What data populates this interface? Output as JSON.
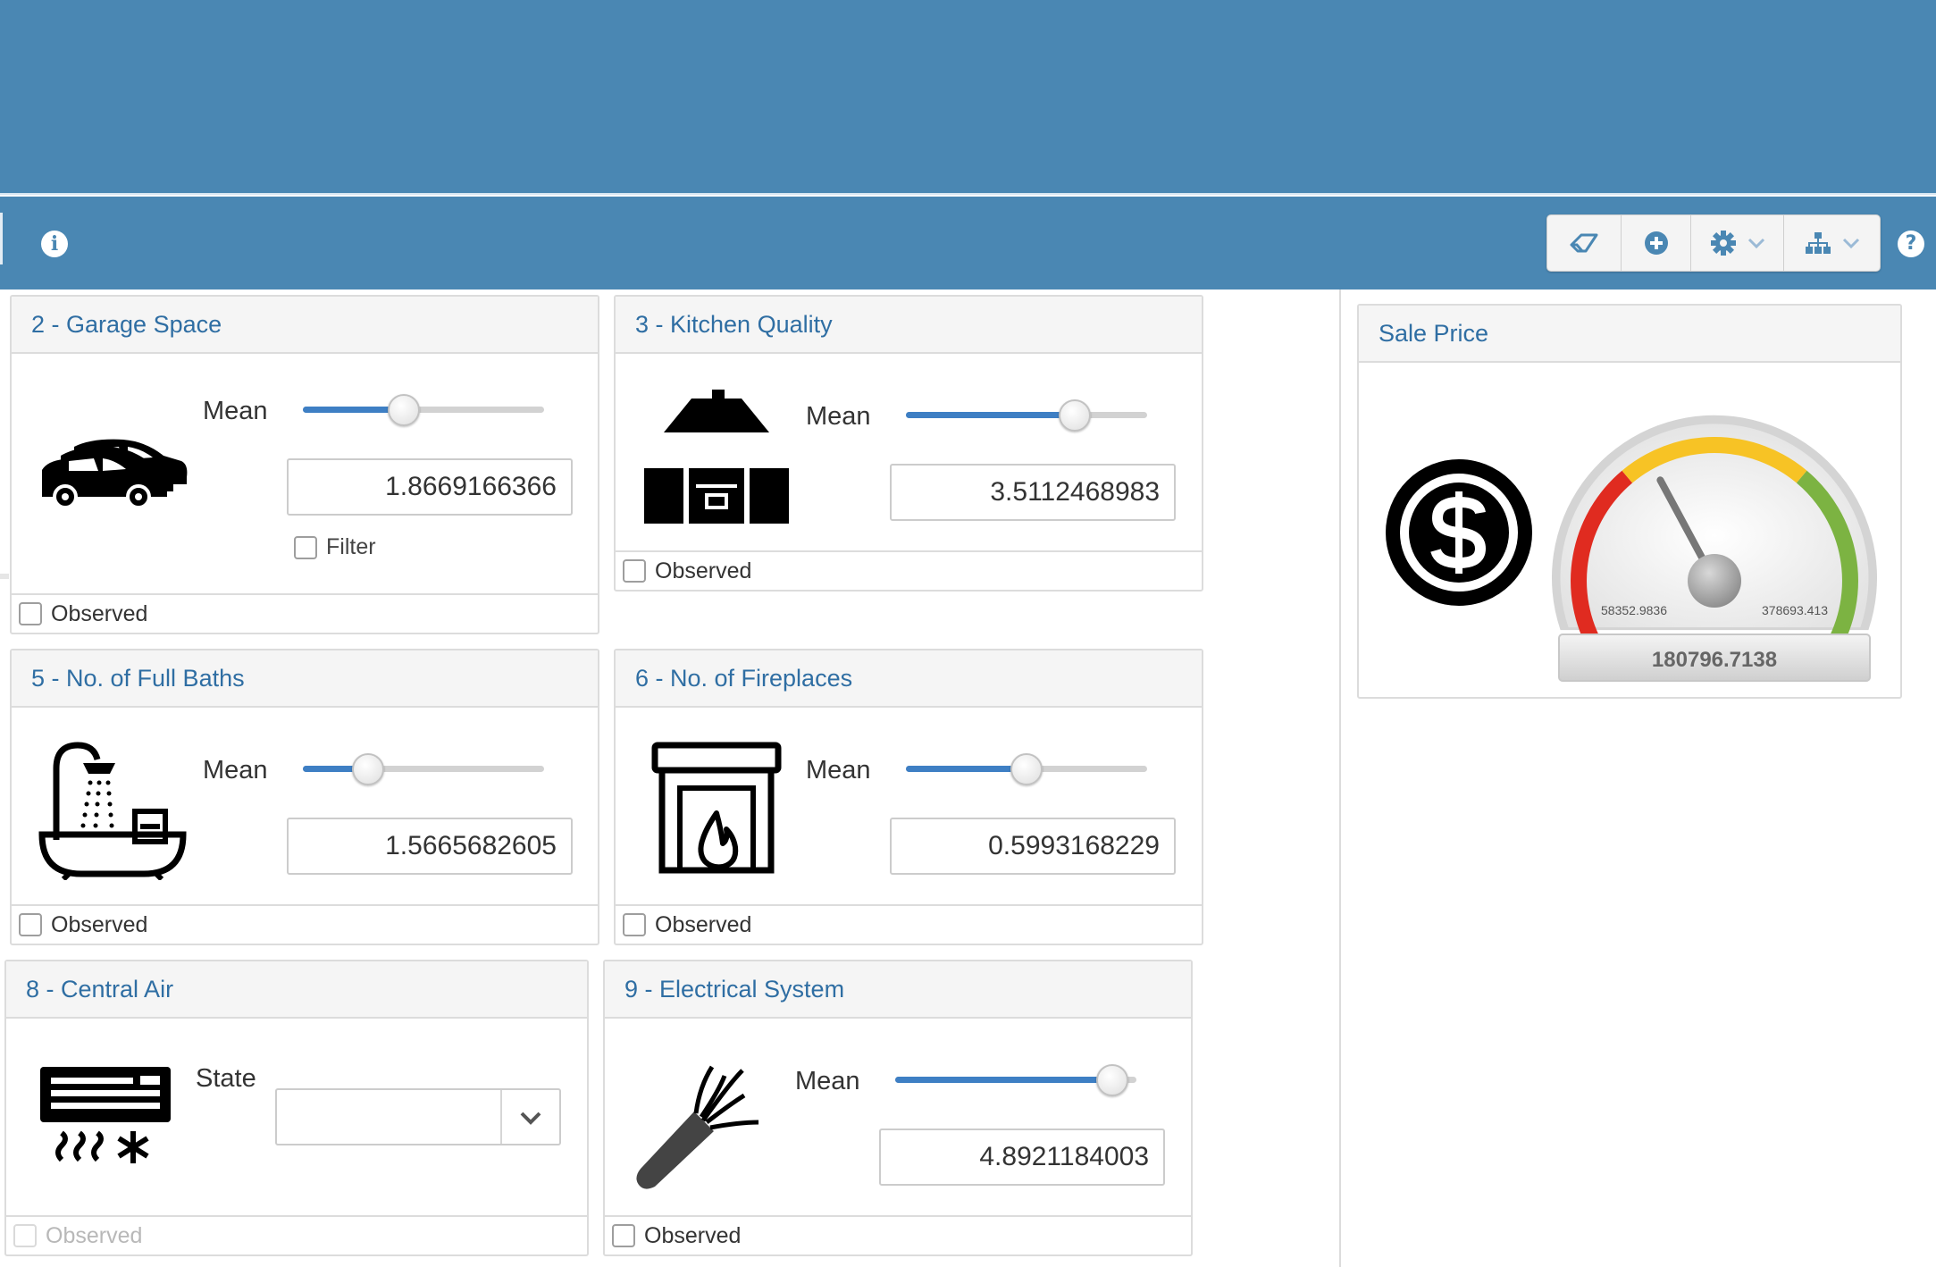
{
  "toolbar": {
    "info_icon": "info-circle-icon",
    "help_icon": "question-circle-icon",
    "buttons": [
      "eraser-icon",
      "plus-circle-icon",
      "gear-icon",
      "hierarchy-icon"
    ]
  },
  "panels": {
    "garage": {
      "title": "2 - Garage Space",
      "mean_label": "Mean",
      "value": "1.8669166366",
      "slider_fraction": 0.42,
      "filter_label": "Filter",
      "observed_label": "Observed",
      "icon": "cars-icon"
    },
    "kitchen": {
      "title": "3 - Kitchen Quality",
      "mean_label": "Mean",
      "value": "3.5112468983",
      "slider_fraction": 0.7,
      "observed_label": "Observed",
      "icon": "kitchen-hood-icon"
    },
    "baths": {
      "title": "5 - No. of Full Baths",
      "mean_label": "Mean",
      "value": "1.5665682605",
      "slider_fraction": 0.27,
      "observed_label": "Observed",
      "icon": "bathtub-shower-icon"
    },
    "fireplaces": {
      "title": "6 - No. of Fireplaces",
      "mean_label": "Mean",
      "value": "0.5993168229",
      "slider_fraction": 0.5,
      "observed_label": "Observed",
      "icon": "fireplace-icon"
    },
    "central_air": {
      "title": "8 - Central Air",
      "state_label": "State",
      "state_value": "",
      "observed_label": "Observed",
      "icon": "air-conditioner-icon"
    },
    "electrical": {
      "title": "9 - Electrical System",
      "mean_label": "Mean",
      "value": "4.8921184003",
      "slider_fraction": 0.9,
      "observed_label": "Observed",
      "icon": "electric-cable-icon"
    },
    "sale_price": {
      "title": "Sale Price",
      "icon": "dollar-circle-icon",
      "gauge": {
        "min_label": "58352.9836",
        "max_label": "378693.413",
        "value_label": "180796.7138",
        "min": 58352.9836,
        "max": 378693.413,
        "value": 180796.7138,
        "colors": {
          "red": "#e02b20",
          "yellow": "#f7c325",
          "green": "#7cb342"
        }
      }
    }
  },
  "colors": {
    "accent": "#4a87b3",
    "link": "#2f6ea3",
    "slider_fill": "#3e7fc4"
  }
}
